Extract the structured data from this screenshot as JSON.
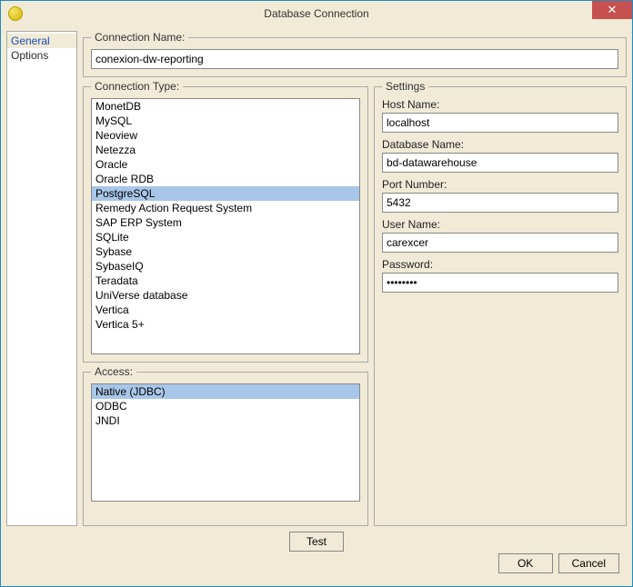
{
  "window": {
    "title": "Database Connection",
    "close_icon": "✕"
  },
  "sidebar": {
    "items": [
      {
        "label": "General",
        "selected": true
      },
      {
        "label": "Options",
        "selected": false
      }
    ]
  },
  "connection_name": {
    "label": "Connection Name:",
    "value": "conexion-dw-reporting"
  },
  "connection_type": {
    "label": "Connection Type:",
    "items": [
      "MonetDB",
      "MySQL",
      "Neoview",
      "Netezza",
      "Oracle",
      "Oracle RDB",
      "PostgreSQL",
      "Remedy Action Request System",
      "SAP ERP System",
      "SQLite",
      "Sybase",
      "SybaseIQ",
      "Teradata",
      "UniVerse database",
      "Vertica",
      "Vertica 5+"
    ],
    "selected": "PostgreSQL"
  },
  "access": {
    "label": "Access:",
    "items": [
      "Native (JDBC)",
      "ODBC",
      "JNDI"
    ],
    "selected": "Native (JDBC)"
  },
  "settings": {
    "legend": "Settings",
    "host_label": "Host Name:",
    "host_value": "localhost",
    "db_label": "Database Name:",
    "db_value": "bd-datawarehouse",
    "port_label": "Port Number:",
    "port_value": "5432",
    "user_label": "User Name:",
    "user_value": "carexcer",
    "pass_label": "Password:",
    "pass_value": "password"
  },
  "buttons": {
    "test": "Test",
    "ok": "OK",
    "cancel": "Cancel"
  }
}
